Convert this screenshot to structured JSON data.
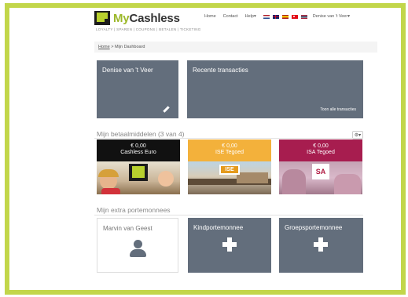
{
  "header": {
    "logo_my": "My",
    "logo_rest": "Cashless",
    "tagline": "LOYALTY | SPAREN | COUPONS | BETALEN | TICKETING",
    "nav": {
      "home": "Home",
      "contact": "Contact",
      "help": "Help",
      "user": "Denise van 't Veer"
    },
    "dropdown_caret": "▾"
  },
  "breadcrumb": {
    "home": "Home",
    "separator": ">",
    "current": "Mijn Dashboard"
  },
  "dashboard": {
    "profile_tile": {
      "title": "Denise van 't Veer"
    },
    "transactions_tile": {
      "title": "Recente transacties",
      "link": "Toon alle transacties"
    }
  },
  "payment_methods": {
    "title": "Mijn betaalmiddelen (3 van 4)",
    "settings_label": "⚙▾",
    "cards": [
      {
        "amount": "€ 0,00",
        "name": "Cashless Euro",
        "color": "#111111"
      },
      {
        "amount": "€ 0,00",
        "name": "ISE Tegoed",
        "color": "#f3b13b",
        "logo": "ISE"
      },
      {
        "amount": "€ 0,00",
        "name": "ISA Tegoed",
        "color": "#a71d4f",
        "logo": "SA"
      }
    ]
  },
  "extra_wallets": {
    "title": "Mijn extra portemonnees",
    "items": [
      {
        "title": "Marvin van Geest",
        "icon": "person-icon"
      },
      {
        "title": "Kindportemonnee",
        "icon": "plus-icon"
      },
      {
        "title": "Groepsportemonnee",
        "icon": "plus-icon"
      }
    ]
  },
  "colors": {
    "accent": "#c2d64a",
    "tile": "#636e7c",
    "ise": "#f3b13b",
    "isa": "#a71d4f"
  }
}
